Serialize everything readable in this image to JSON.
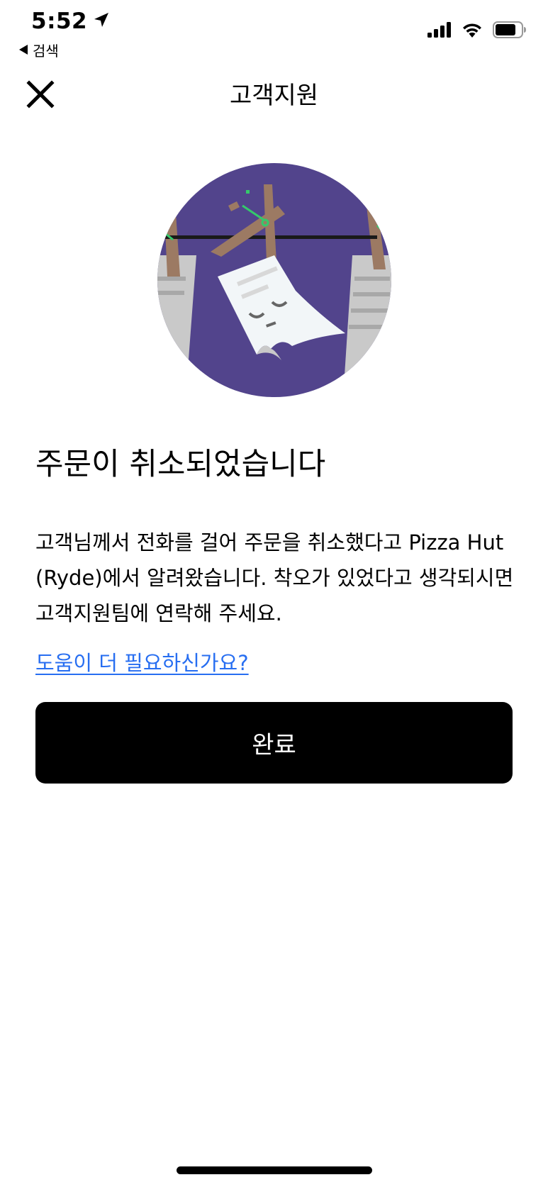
{
  "status_bar": {
    "time": "5:52",
    "back_label": "검색",
    "icons": [
      "location-arrow-icon",
      "signal-icon",
      "wifi-icon",
      "battery-icon"
    ]
  },
  "header": {
    "title": "고객지원",
    "close_icon": "close-icon"
  },
  "illustration": {
    "name": "cancelled-receipt-clothesline-illustration",
    "bg_color": "#52448C"
  },
  "content": {
    "headline": "주문이 취소되었습니다",
    "message": "고객님께서 전화를 걸어 주문을 취소했다고 Pizza Hut (Ryde)에서 알려왔습니다. 착오가 있었다고 생각되시면 고객지원팀에 연락해 주세요.",
    "help_link": "도움이 더 필요하신가요?"
  },
  "actions": {
    "done_label": "완료"
  },
  "colors": {
    "link": "#276EF1",
    "button_bg": "#000000",
    "button_text": "#FFFFFF"
  }
}
